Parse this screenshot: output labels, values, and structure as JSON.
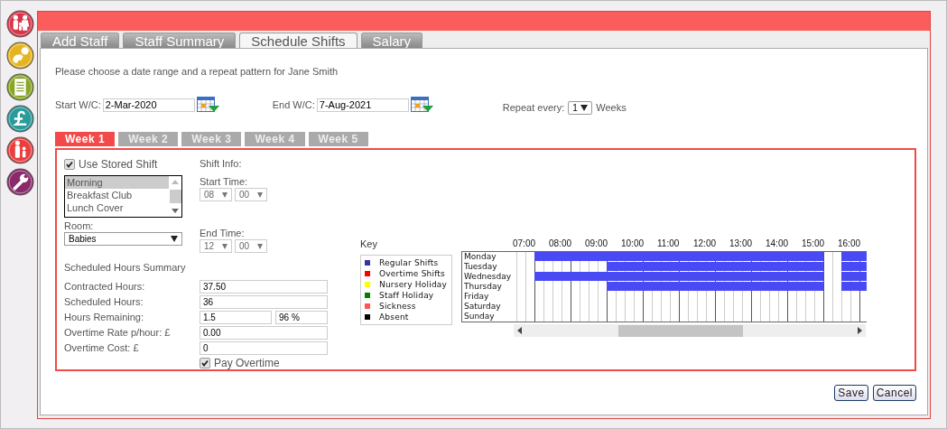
{
  "nav_icons": [
    {
      "kind": "family"
    },
    {
      "kind": "baby"
    },
    {
      "kind": "list"
    },
    {
      "kind": "pound"
    },
    {
      "kind": "parent"
    },
    {
      "kind": "wrench"
    }
  ],
  "tabs": [
    {
      "label": "Add Staff",
      "selected": false
    },
    {
      "label": "Staff Summary",
      "selected": false
    },
    {
      "label": "Schedule Shifts",
      "selected": true
    },
    {
      "label": "Salary",
      "selected": false
    }
  ],
  "instruction": "Please choose a date range and a repeat pattern for Jane Smith",
  "start_wc": {
    "label": "Start W/C:",
    "value": "2-Mar-2020"
  },
  "end_wc": {
    "label": "End W/C:",
    "value": "7-Aug-2021"
  },
  "repeat": {
    "label": "Repeat every:",
    "value": "1",
    "unit": "Weeks"
  },
  "week_tabs": [
    {
      "label": "Week 1",
      "selected": true
    },
    {
      "label": "Week 2",
      "selected": false
    },
    {
      "label": "Week 3",
      "selected": false
    },
    {
      "label": "Week 4",
      "selected": false
    },
    {
      "label": "Week 5",
      "selected": false
    }
  ],
  "use_stored_shift": {
    "label": "Use Stored Shift",
    "checked": true
  },
  "stored_shifts": [
    {
      "label": "Morning",
      "selected": true
    },
    {
      "label": "Breakfast Club",
      "selected": false
    },
    {
      "label": "Lunch Cover",
      "selected": false
    }
  ],
  "shift_info": {
    "title": "Shift Info:",
    "start_label": "Start Time:",
    "start_hour": "08",
    "start_minute": "00",
    "end_label": "End Time:",
    "end_hour": "12",
    "end_minute": "00"
  },
  "room": {
    "label": "Room:",
    "value": "Babies"
  },
  "summary": {
    "title": "Scheduled Hours Summary",
    "rows": [
      {
        "label": "Contracted Hours:",
        "value": "37.50"
      },
      {
        "label": "Scheduled Hours:",
        "value": "36"
      },
      {
        "label": "Hours Remaining:",
        "value": "1.5",
        "extra": "96 %"
      },
      {
        "label": "Overtime Rate p/hour: £",
        "value": "0.00"
      },
      {
        "label": "Overtime Cost: £",
        "value": "0"
      }
    ]
  },
  "pay_overtime": {
    "label": "Pay Overtime",
    "checked": true
  },
  "schedule": {
    "key_title": "Key",
    "legend": [
      {
        "label": "Regular Shifts",
        "color": "#3333aa"
      },
      {
        "label": "Overtime Shifts",
        "color": "#ff0000"
      },
      {
        "label": "Nursery Holiday",
        "color": "#ffff00"
      },
      {
        "label": "Staff Holiday",
        "color": "#008000"
      },
      {
        "label": "Sickness",
        "color": "#ff5555"
      },
      {
        "label": "Absent",
        "color": "#000000"
      }
    ],
    "hours": [
      "07:00",
      "08:00",
      "09:00",
      "10:00",
      "11:00",
      "12:00",
      "13:00",
      "14:00",
      "15:00",
      "16:00"
    ],
    "days": [
      {
        "name": "Monday"
      },
      {
        "name": "Tuesday"
      },
      {
        "name": "Wednesday"
      },
      {
        "name": "Thursday"
      },
      {
        "name": "Friday"
      },
      {
        "name": "Saturday"
      },
      {
        "name": "Sunday"
      }
    ]
  },
  "buttons": [
    "Save",
    "Cancel"
  ]
}
